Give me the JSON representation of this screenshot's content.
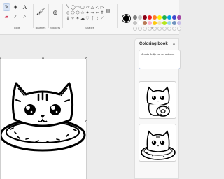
{
  "ribbon": {
    "groups": {
      "tools": "Tools",
      "brushes": "Brushes",
      "stickers": "Stickers",
      "shapes": "Shapes",
      "colors": "Colors"
    },
    "tool_icons": [
      "pencil-icon",
      "fill-bucket-icon",
      "text-icon",
      "eraser-icon",
      "color-picker-icon",
      "magnifier-icon"
    ],
    "shape_glyphs": [
      "╲",
      "◯",
      "▭",
      "▢",
      "▱",
      "△",
      "◁",
      "▷",
      "◇",
      "⬠",
      "⬡",
      "☆",
      "✦",
      "⇒",
      "⇐",
      "⇑",
      "⇓",
      "✧",
      "✶",
      "☁",
      "♡",
      "ʃ",
      "⌇",
      "⟋"
    ],
    "current_color": "#000000",
    "palette": [
      "#7f7f7f",
      "#c3c3c3",
      "#880015",
      "#ed1c24",
      "#ff7f27",
      "#fff200",
      "#22b14c",
      "#00a2e8",
      "#3f48cc",
      "#a349a4",
      "#c3c3c3",
      "#ffffff",
      "#b97a57",
      "#ffaec9",
      "#ffc90e",
      "#efe4b0",
      "#b5e61d",
      "#99d9ea",
      "#7092be",
      "#c8bfe7"
    ]
  },
  "panel": {
    "title": "Coloring book",
    "close_glyph": "✕",
    "prompt": "A cute fluffy cat on a donut"
  }
}
